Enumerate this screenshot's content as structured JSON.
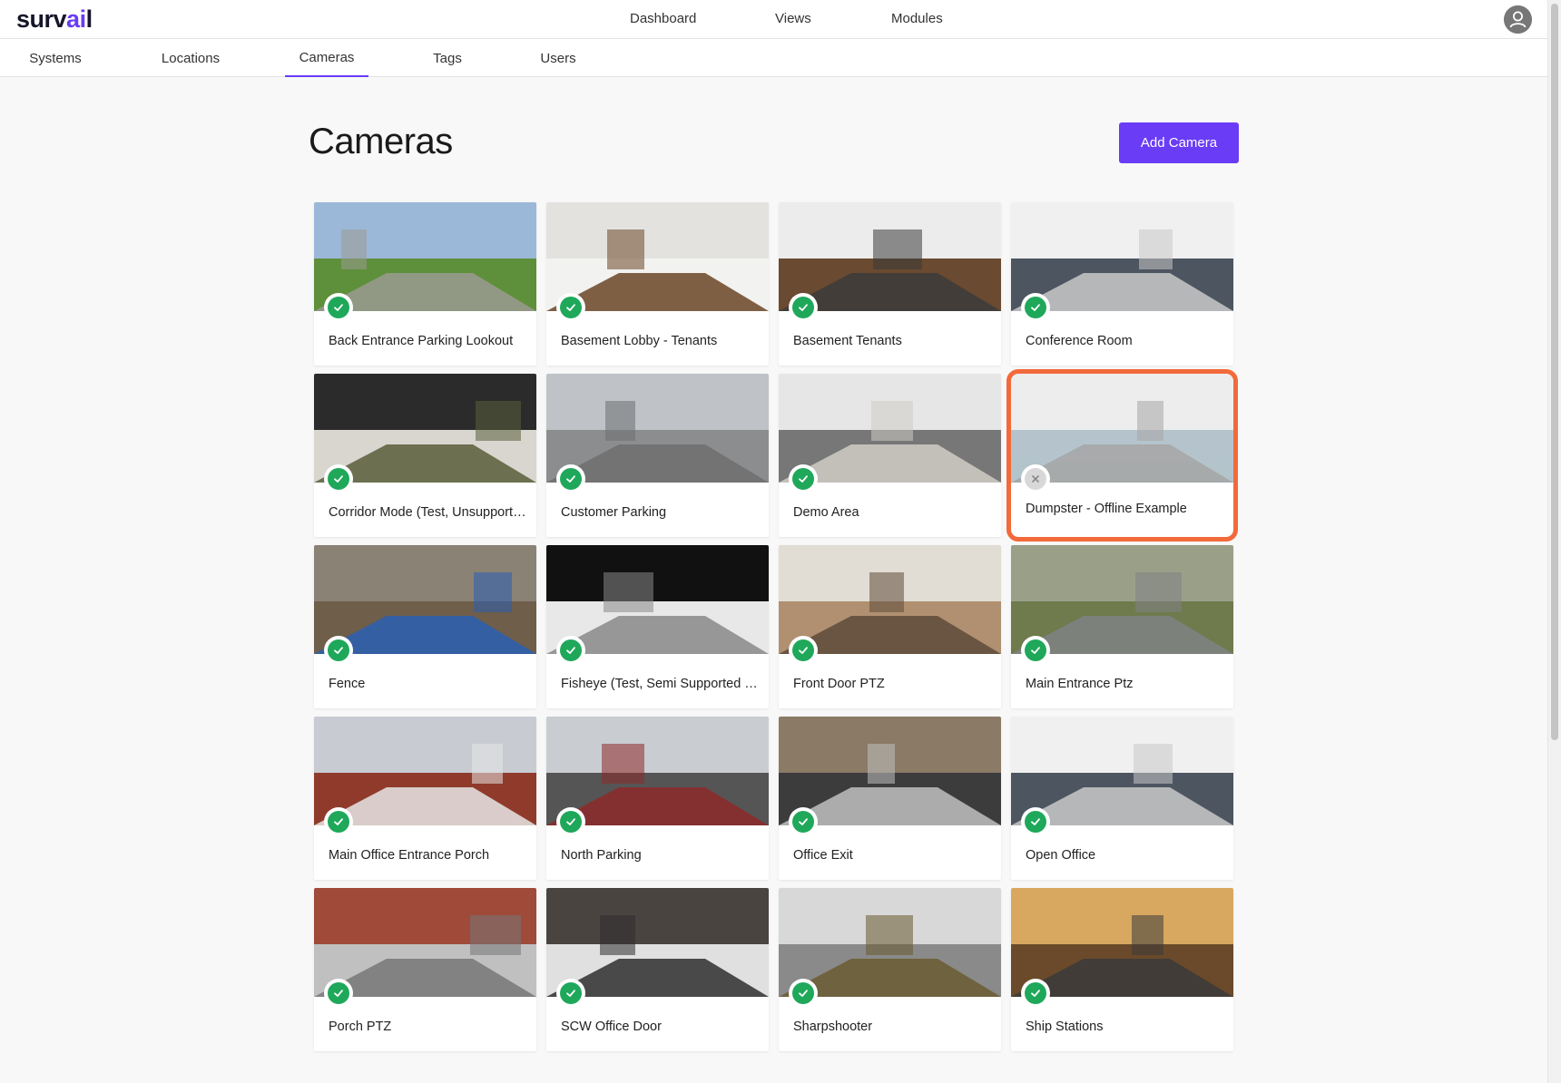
{
  "brand": {
    "name_prefix": "surv",
    "name_accent": "ai",
    "name_suffix": "l",
    "accent_color": "#6a3cf5"
  },
  "top_nav": {
    "items": [
      "Dashboard",
      "Views",
      "Modules"
    ]
  },
  "sub_nav": {
    "tabs": [
      "Systems",
      "Locations",
      "Cameras",
      "Tags",
      "Users"
    ],
    "active": "Cameras"
  },
  "page": {
    "title": "Cameras",
    "add_button": "Add Camera"
  },
  "status_colors": {
    "online": "#1fa85a",
    "offline": "#d8d8d8",
    "highlight": "#f26a3a"
  },
  "cameras": [
    {
      "name": "Back Entrance Parking Lookout",
      "status": "online"
    },
    {
      "name": "Basement Lobby - Tenants",
      "status": "online"
    },
    {
      "name": "Basement Tenants",
      "status": "online"
    },
    {
      "name": "Conference Room",
      "status": "online"
    },
    {
      "name": "Corridor Mode (Test, Unsupported)",
      "status": "online"
    },
    {
      "name": "Customer Parking",
      "status": "online"
    },
    {
      "name": "Demo Area",
      "status": "online"
    },
    {
      "name": "Dumpster - Offline Example",
      "status": "offline"
    },
    {
      "name": "Fence",
      "status": "online"
    },
    {
      "name": "Fisheye (Test, Semi Supported View)",
      "status": "online"
    },
    {
      "name": "Front Door PTZ",
      "status": "online"
    },
    {
      "name": "Main Entrance Ptz",
      "status": "online"
    },
    {
      "name": "Main Office Entrance Porch",
      "status": "online"
    },
    {
      "name": "North Parking",
      "status": "online"
    },
    {
      "name": "Office Exit",
      "status": "online"
    },
    {
      "name": "Open Office",
      "status": "online"
    },
    {
      "name": "Porch PTZ",
      "status": "online"
    },
    {
      "name": "SCW Office Door",
      "status": "online"
    },
    {
      "name": "Sharpshooter",
      "status": "online"
    },
    {
      "name": "Ship Stations",
      "status": "online"
    }
  ]
}
